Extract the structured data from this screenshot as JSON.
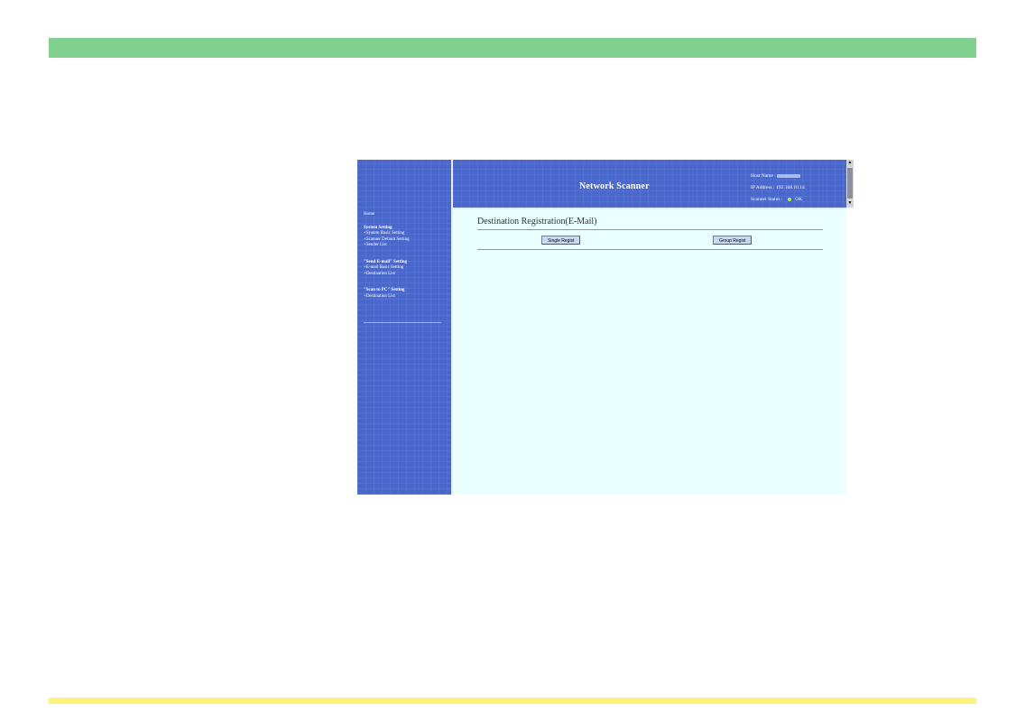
{
  "banner": {
    "title": "Network Scanner",
    "host_name_label": "Host Name :",
    "ip_label": "IP Address :",
    "ip_value": "192.168.10.14",
    "status_label": "Scanner Status :",
    "status_value": "OK"
  },
  "nav": {
    "home": "Home",
    "sections": [
      {
        "title": "System Setting",
        "items": [
          "+System Basic Setting",
          "+Scanner Default Setting",
          "+Sender List"
        ]
      },
      {
        "title": "\"Send E-mail\" Setting",
        "items": [
          "+E-mail Basic Setting",
          "+Destination List"
        ]
      },
      {
        "title": "\"Scan to PC\" Setting",
        "items": [
          "+Destination List"
        ]
      }
    ]
  },
  "content": {
    "heading": "Destination Registration(E-Mail)",
    "single_button": "Single Regist",
    "group_button": "Group Regist"
  },
  "colors": {
    "top_band": "#80d18f",
    "bottom_band": "#fdf37a",
    "nav_blue": "#4a67cc",
    "content_bg": "#eaffff",
    "status_ok": "#b6f23a"
  },
  "icons": {
    "scroll_up": "up-arrow-icon",
    "scroll_down": "down-arrow-icon",
    "status": "status-dot-icon"
  }
}
